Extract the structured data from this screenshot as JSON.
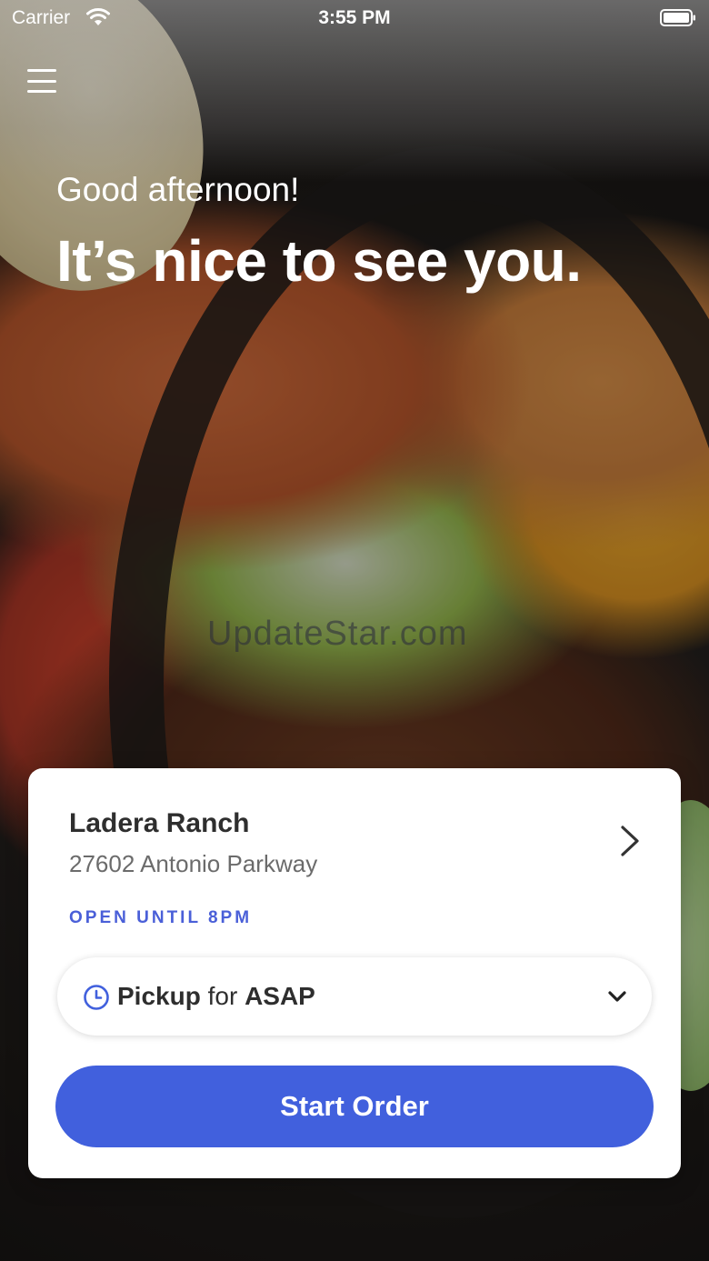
{
  "status_bar": {
    "carrier": "Carrier",
    "time": "3:55 PM",
    "wifi_icon": "wifi-icon",
    "battery_icon": "battery-icon"
  },
  "header": {
    "menu_icon": "hamburger-menu-icon",
    "greeting": "Good afternoon!",
    "headline": "It’s nice to see you."
  },
  "watermark": "UpdateStar.com",
  "location": {
    "name": "Ladera Ranch",
    "address": "27602 Antonio Parkway",
    "hours": "OPEN UNTIL 8PM",
    "chevron_icon": "chevron-right-icon"
  },
  "order_mode": {
    "icon": "clock-icon",
    "mode": "Pickup",
    "connector": "for",
    "time": "ASAP",
    "dropdown_icon": "chevron-down-icon"
  },
  "actions": {
    "start_order": "Start Order"
  },
  "colors": {
    "accent": "#4160DD",
    "hours_text": "#4A5FD8",
    "card_bg": "#FFFFFF",
    "primary_text": "#2E2E2E",
    "secondary_text": "#6B6B6B"
  }
}
